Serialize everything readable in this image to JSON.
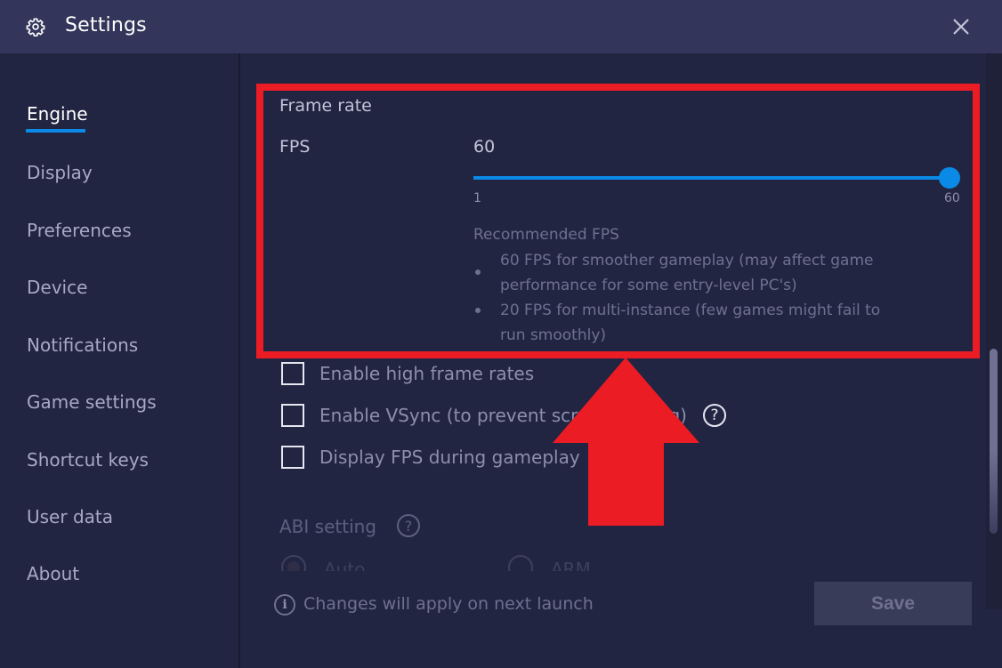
{
  "window": {
    "title": "Settings",
    "title_icon": "gear-icon",
    "close_icon": "close-icon"
  },
  "sidebar": {
    "items": [
      {
        "label": "Engine",
        "active": true
      },
      {
        "label": "Display",
        "active": false
      },
      {
        "label": "Preferences",
        "active": false
      },
      {
        "label": "Device",
        "active": false
      },
      {
        "label": "Notifications",
        "active": false
      },
      {
        "label": "Game settings",
        "active": false
      },
      {
        "label": "Shortcut keys",
        "active": false
      },
      {
        "label": "User data",
        "active": false
      },
      {
        "label": "About",
        "active": false
      }
    ]
  },
  "frame_rate": {
    "section_title": "Frame rate",
    "fps_label": "FPS",
    "fps_value": "60",
    "slider": {
      "min": 1,
      "max": 60,
      "value": 60,
      "min_label": "1",
      "max_label": "60"
    },
    "recommended_title": "Recommended FPS",
    "recommendations": [
      "60 FPS for smoother gameplay (may affect game performance for some entry-level PC's)",
      "20 FPS for multi-instance (few games might fail to run smoothly)"
    ]
  },
  "options": [
    {
      "label": "Enable high frame rates",
      "checked": false,
      "help": false
    },
    {
      "label": "Enable VSync (to prevent screen tearing)",
      "checked": false,
      "help": true
    },
    {
      "label": "Display FPS during gameplay",
      "checked": false,
      "help": false
    }
  ],
  "abi": {
    "title": "ABI setting",
    "help_glyph": "?",
    "options": [
      {
        "label": "Auto",
        "selected": true
      },
      {
        "label": "ARM",
        "selected": false
      }
    ]
  },
  "footer": {
    "info_glyph": "i",
    "info_text": "Changes will apply on next launch",
    "save_label": "Save"
  },
  "annotation": {
    "highlight_color": "#ec1c24",
    "arrow_color": "#ec1c24"
  },
  "colors": {
    "accent": "#0a8ae6",
    "titlebar": "#33365a",
    "background": "#222542"
  }
}
